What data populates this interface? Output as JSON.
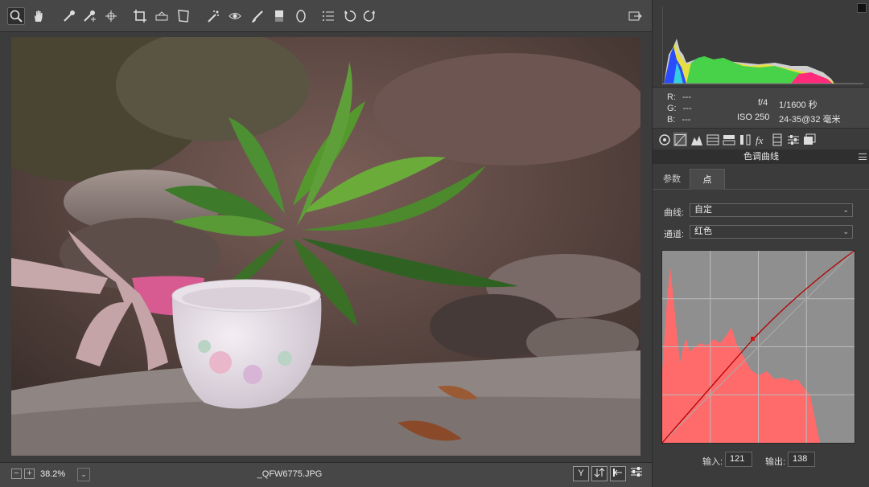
{
  "toolbar": {
    "tools": [
      {
        "name": "zoom-tool",
        "active": true
      },
      {
        "name": "hand-tool"
      },
      {
        "name": "white-balance-tool"
      },
      {
        "name": "color-sampler-tool"
      },
      {
        "name": "targeted-adjustment-tool"
      },
      {
        "name": "crop-tool"
      },
      {
        "name": "straighten-tool"
      },
      {
        "name": "transform-tool"
      },
      {
        "name": "spot-removal-tool"
      },
      {
        "name": "red-eye-tool"
      },
      {
        "name": "adjustment-brush-tool"
      },
      {
        "name": "graduated-filter-tool"
      },
      {
        "name": "radial-filter-tool"
      },
      {
        "name": "preferences-tool"
      },
      {
        "name": "rotate-left-tool"
      },
      {
        "name": "rotate-right-tool"
      }
    ]
  },
  "bottombar": {
    "zoom_out": "−",
    "zoom_in": "+",
    "zoom_level": "38.2%",
    "zoom_caret": "⌄",
    "filename": "_QFW6775.JPG",
    "y_button": "Y"
  },
  "info": {
    "r_label": "R:",
    "r_value": "---",
    "g_label": "G:",
    "g_value": "---",
    "b_label": "B:",
    "b_value": "---",
    "aperture": "f/4",
    "shutter": "1/1600 秒",
    "iso": "ISO 250",
    "lens": "24-35@32 毫米"
  },
  "panel": {
    "section_title": "色调曲线",
    "tabs": [
      {
        "label": "参数"
      },
      {
        "label": "点"
      }
    ],
    "curve_label": "曲线:",
    "curve_value": "自定",
    "channel_label": "通道:",
    "channel_value": "红色",
    "input_label": "输入:",
    "input_value": "121",
    "output_label": "输出:",
    "output_value": "138"
  },
  "colors": {
    "curve_histogram": "#ff6b6b",
    "curve_line": "#b30000",
    "panel_bg": "#3b3b3b"
  }
}
